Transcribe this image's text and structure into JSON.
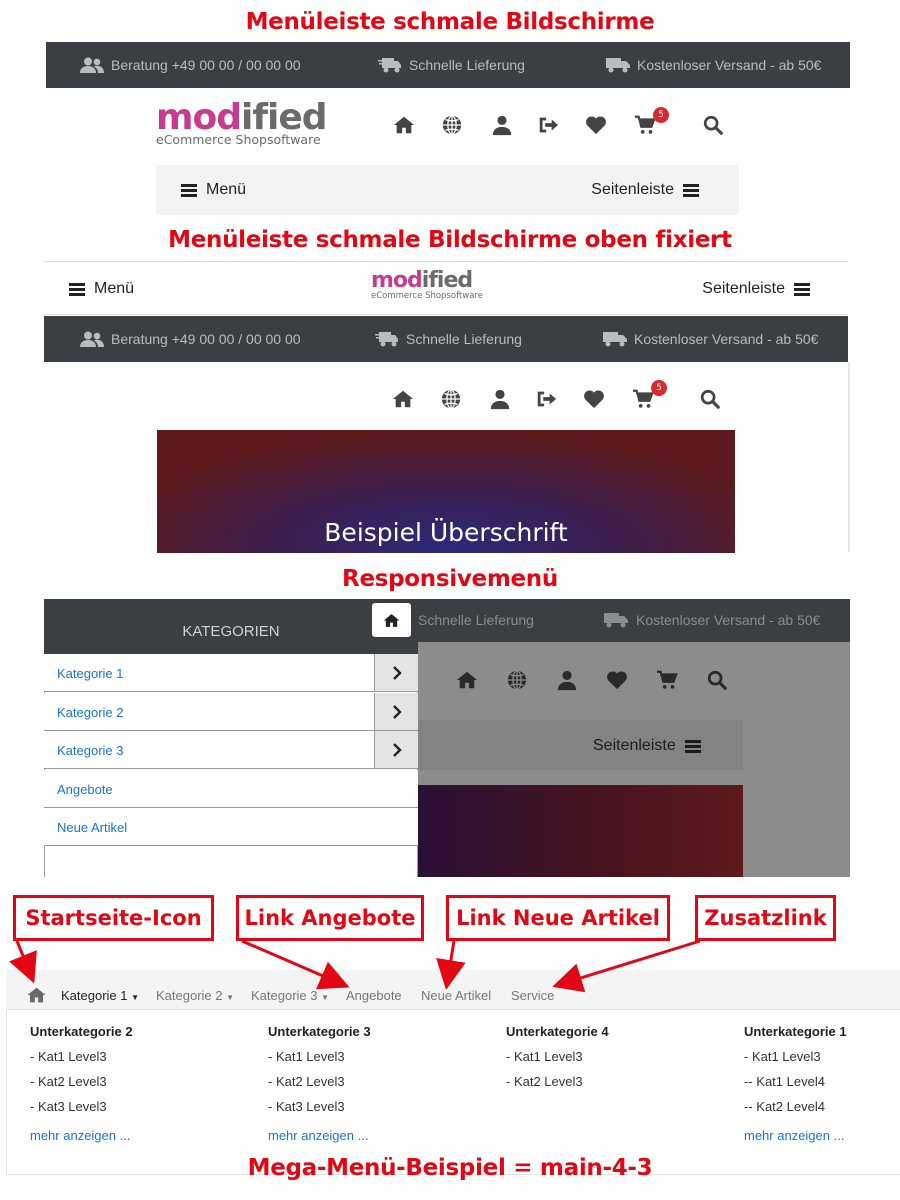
{
  "colors": {
    "heading": "#e30613",
    "topbar": "#3b3e43",
    "menubar": "#f3f3f4",
    "link": "#1a73d9",
    "badge": "#d9292b",
    "logo_accent": "#c83c90"
  },
  "sections": {
    "s1_title": "Menüleiste schmale Bildschirme",
    "s2_title": "Menüleiste schmale Bildschirme oben fixiert",
    "s3_title": "Responsivemenü",
    "s4_title": "Mega-Menü-Beispiel = main-4-3"
  },
  "topbar": {
    "advice": "Beratung +49 00 00 / 00 00 00",
    "delivery": "Schnelle Lieferung",
    "shipping": "Kostenloser Versand - ab 50€"
  },
  "logo": {
    "word_a": "mod",
    "word_b": "ified",
    "tagline": "eCommerce Shopsoftware"
  },
  "cart": {
    "count": "5"
  },
  "menubar": {
    "menu": "Menü",
    "sidebar": "Seitenleiste"
  },
  "hero": {
    "title": "Beispiel Überschrift"
  },
  "responsive": {
    "header": "KATEGORIEN",
    "items": [
      "Kategorie 1",
      "Kategorie 2",
      "Kategorie 3",
      "Angebote",
      "Neue Artikel"
    ]
  },
  "callouts": {
    "home": "Startseite-Icon",
    "offers": "Link Angebote",
    "new": "Link Neue Artikel",
    "extra": "Zusatzlink"
  },
  "megamenu": {
    "nav": [
      "Kategorie 1",
      "Kategorie 2",
      "Kategorie 3",
      "Angebote",
      "Neue Artikel",
      "Service"
    ],
    "columns": [
      {
        "title": "Unterkategorie 2",
        "items": [
          "- Kat1 Level3",
          "- Kat2 Level3",
          "- Kat3 Level3"
        ],
        "more": "mehr anzeigen ..."
      },
      {
        "title": "Unterkategorie 3",
        "items": [
          "- Kat1 Level3",
          "- Kat2 Level3",
          "- Kat3 Level3"
        ],
        "more": "mehr anzeigen ..."
      },
      {
        "title": "Unterkategorie 4",
        "items": [
          "- Kat1 Level3",
          "- Kat2 Level3"
        ],
        "more": ""
      },
      {
        "title": "Unterkategorie 1",
        "items": [
          "- Kat1 Level3",
          "-- Kat1 Level4",
          "-- Kat2 Level4"
        ],
        "more": "mehr anzeigen ..."
      }
    ]
  }
}
